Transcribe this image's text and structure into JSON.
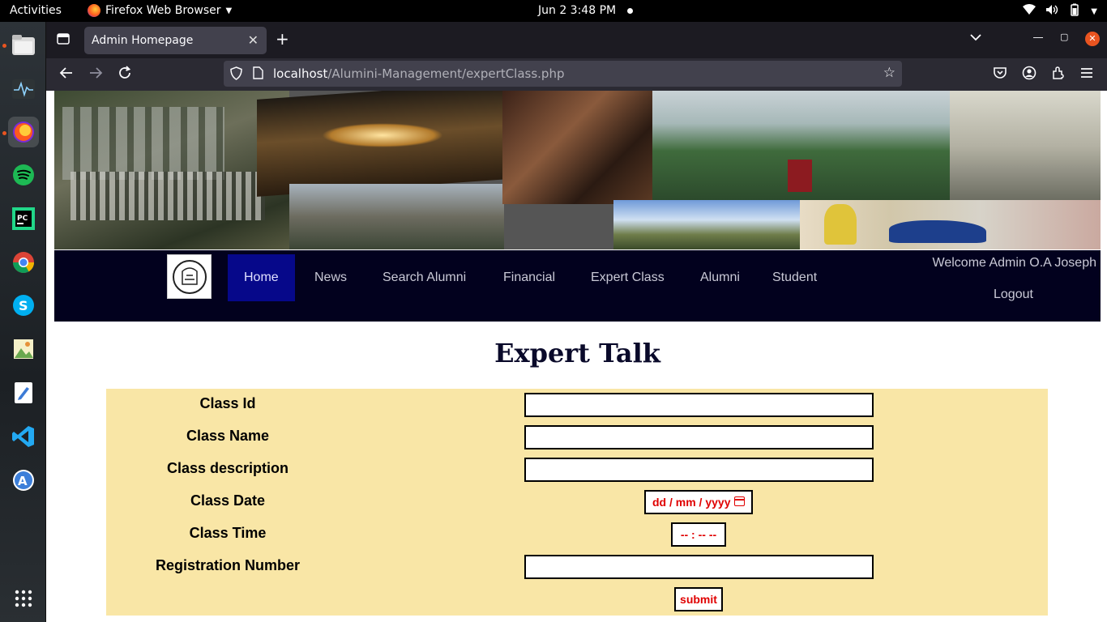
{
  "topbar": {
    "activities": "Activities",
    "app_name": "Firefox Web Browser",
    "clock": "Jun 2  3:48 PM"
  },
  "dock": {
    "icons": [
      "files-icon",
      "system-monitor-icon",
      "firefox-icon",
      "spotify-icon",
      "pycharm-icon",
      "chrome-icon",
      "skype-icon",
      "image-viewer-icon",
      "text-editor-icon",
      "vscode-icon",
      "software-center-icon",
      "app-grid-icon"
    ]
  },
  "browser": {
    "tab_title": "Admin Homepage",
    "url_host": "localhost",
    "url_path": "/Alumini-Management/expertClass.php"
  },
  "nav": {
    "items": [
      "Home",
      "News",
      "Search Alumni",
      "Financial",
      "Expert Class",
      "Alumni",
      "Student"
    ],
    "active": "Home",
    "welcome": "Welcome Admin O.A Joseph",
    "logout": "Logout"
  },
  "page": {
    "heading": "Expert Talk"
  },
  "form": {
    "fields": [
      {
        "label": "Class Id",
        "value": ""
      },
      {
        "label": "Class Name",
        "value": ""
      },
      {
        "label": "Class description",
        "value": ""
      },
      {
        "label": "Class Date",
        "placeholder": "dd / mm / yyyy"
      },
      {
        "label": "Class Time",
        "placeholder": "-- : --  --"
      },
      {
        "label": "Registration Number",
        "value": ""
      }
    ],
    "submit_label": "submit"
  },
  "colors": {
    "nav_bg": "#02011e",
    "nav_active": "#06088a",
    "form_bg": "#f9e6a6",
    "input_accent": "#e00000"
  }
}
